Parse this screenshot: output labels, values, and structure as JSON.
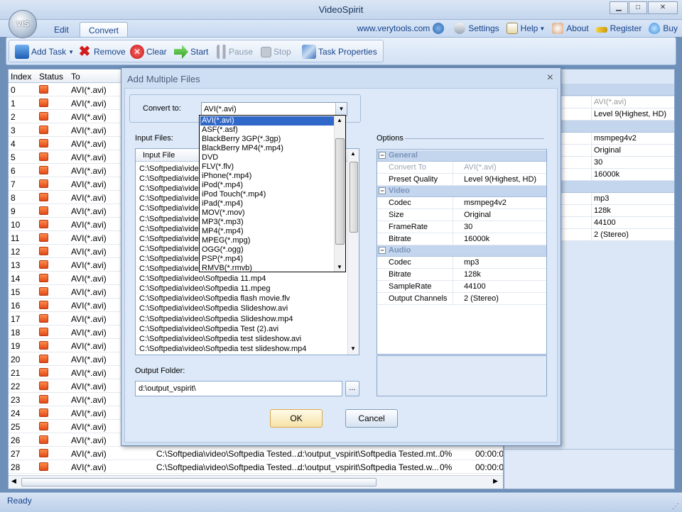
{
  "window": {
    "title": "VideoSpirit",
    "logo": "VIS"
  },
  "ribbon": {
    "tabs": [
      "Edit",
      "Convert"
    ],
    "links": {
      "site": "www.verytools.com",
      "settings": "Settings",
      "help": "Help",
      "about": "About",
      "register": "Register",
      "buy": "Buy"
    }
  },
  "toolbar": {
    "add_task": "Add Task",
    "remove": "Remove",
    "clear": "Clear",
    "start": "Start",
    "pause": "Pause",
    "stop": "Stop",
    "task_properties": "Task Properties"
  },
  "tasklist": {
    "columns": [
      "Index",
      "Status",
      "To"
    ],
    "format": "AVI(*.avi)",
    "rows": [
      "0",
      "1",
      "2",
      "3",
      "4",
      "5",
      "6",
      "7",
      "8",
      "9",
      "10",
      "11",
      "12",
      "13",
      "14",
      "15",
      "16",
      "17",
      "18",
      "19",
      "20",
      "21",
      "22",
      "23",
      "24",
      "25",
      "26",
      "27",
      "28"
    ],
    "row27": {
      "source": "C:\\Softpedia\\video\\Softpedia Tested....",
      "dest": "d:\\output_vspirit\\Softpedia Tested.mt...",
      "progress": "0%",
      "time": "00:00:0"
    },
    "row28": {
      "source": "C:\\Softpedia\\video\\Softpedia Tested....",
      "dest": "d:\\output_vspirit\\Softpedia Tested.w...",
      "progress": "0%",
      "time": "00:00:0"
    }
  },
  "right_panel": {
    "rows": [
      {
        "k": "",
        "v": "AVI(*.avi)",
        "dim": true
      },
      {
        "k": "y",
        "v": "Level 9(Highest, HD)"
      },
      {
        "k": "",
        "v": "msmpeg4v2"
      },
      {
        "k": "",
        "v": "Original"
      },
      {
        "k": "",
        "v": "30"
      },
      {
        "k": "",
        "v": "16000k"
      },
      {
        "k": "",
        "v": "mp3"
      },
      {
        "k": "",
        "v": "128k"
      },
      {
        "k": "",
        "v": "44100"
      },
      {
        "k": "nels",
        "v": "2 (Stereo)"
      }
    ]
  },
  "status": {
    "text": "Ready"
  },
  "dialog": {
    "title": "Add Multiple Files",
    "close": "×",
    "convert_to_label": "Convert to:",
    "convert_value": "AVI(*.avi)",
    "formats": [
      "AVI(*.avi)",
      "ASF(*.asf)",
      "BlackBerry 3GP(*.3gp)",
      "BlackBerry MP4(*.mp4)",
      "DVD",
      "FLV(*.flv)",
      "iPhone(*.mp4)",
      "iPod(*.mp4)",
      "iPod Touch(*.mp4)",
      "iPad(*.mp4)",
      "MOV(*.mov)",
      "MP3(*.mp3)",
      "MP4(*.mp4)",
      "MPEG(*.mpg)",
      "OGG(*.ogg)",
      "PSP(*.mp4)",
      "RMVB(*.rmvb)"
    ],
    "input_files_label": "Input Files:",
    "input_header": "Input File",
    "files": [
      "C:\\Softpedia\\vide",
      "C:\\Softpedia\\vide",
      "C:\\Softpedia\\vide",
      "C:\\Softpedia\\vide",
      "C:\\Softpedia\\vide",
      "C:\\Softpedia\\vide",
      "C:\\Softpedia\\vide",
      "C:\\Softpedia\\vide",
      "C:\\Softpedia\\vide",
      "C:\\Softpedia\\vide",
      "C:\\Softpedia\\vide",
      "C:\\Softpedia\\video\\Softpedia 11.mp4",
      "C:\\Softpedia\\video\\Softpedia 11.mpeg",
      "C:\\Softpedia\\video\\Softpedia flash movie.flv",
      "C:\\Softpedia\\video\\Softpedia Slideshow.avi",
      "C:\\Softpedia\\video\\Softpedia Slideshow.mp4",
      "C:\\Softpedia\\video\\Softpedia Test (2).avi",
      "C:\\Softpedia\\video\\Softpedia test slideshow.avi",
      "C:\\Softpedia\\video\\Softpedia test slideshow.mp4"
    ],
    "options_label": "Options",
    "groups": [
      {
        "name": "General",
        "rows": [
          {
            "k": "Convert To",
            "v": "AVI(*.avi)",
            "dim": true
          },
          {
            "k": "Preset Quality",
            "v": "Level 9(Highest, HD)"
          }
        ]
      },
      {
        "name": "Video",
        "rows": [
          {
            "k": "Codec",
            "v": "msmpeg4v2"
          },
          {
            "k": "Size",
            "v": "Original"
          },
          {
            "k": "FrameRate",
            "v": "30"
          },
          {
            "k": "Bitrate",
            "v": "16000k"
          }
        ]
      },
      {
        "name": "Audio",
        "rows": [
          {
            "k": "Codec",
            "v": "mp3"
          },
          {
            "k": "Bitrate",
            "v": "128k"
          },
          {
            "k": "SampleRate",
            "v": "44100"
          },
          {
            "k": "Output Channels",
            "v": "2 (Stereo)"
          }
        ]
      }
    ],
    "output_label": "Output Folder:",
    "output_value": "d:\\output_vspirit\\",
    "browse": "...",
    "ok": "OK",
    "cancel": "Cancel"
  },
  "colors": {
    "accent": "#15428b",
    "status_icon": "#e0491a",
    "selection": "#3068c9"
  }
}
